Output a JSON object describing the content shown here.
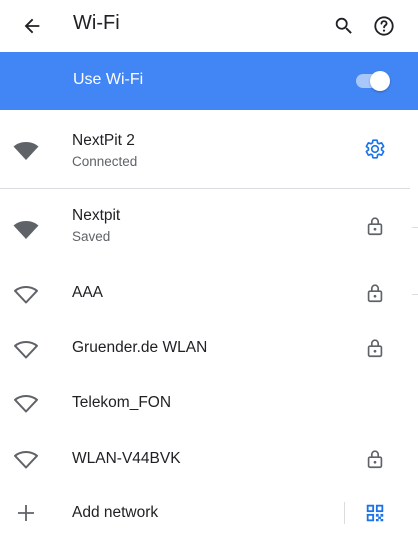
{
  "appbar": {
    "title": "Wi-Fi"
  },
  "use_wifi": {
    "label": "Use Wi-Fi",
    "enabled": true,
    "accent_color": "#4285f4"
  },
  "connected": {
    "name": "NextPit 2",
    "status": "Connected",
    "signal": "full",
    "trailing_icon": "gear-icon"
  },
  "networks": [
    {
      "name": "Nextpit",
      "status": "Saved",
      "signal": "full",
      "locked": true
    },
    {
      "name": "AAA",
      "status": "",
      "signal": "outline",
      "locked": true
    },
    {
      "name": "Gruender.de WLAN",
      "status": "",
      "signal": "outline",
      "locked": true
    },
    {
      "name": "Telekom_FON",
      "status": "",
      "signal": "outline",
      "locked": false
    },
    {
      "name": "WLAN-V44BVK",
      "status": "",
      "signal": "outline",
      "locked": true
    }
  ],
  "add_network": {
    "label": "Add network",
    "trailing_icon": "qr-code-icon"
  },
  "colors": {
    "text": "#202124",
    "secondary": "#5f6368",
    "icon": "#5f6368",
    "link_icon": "#1a73e8",
    "divider": "#dadce0"
  }
}
